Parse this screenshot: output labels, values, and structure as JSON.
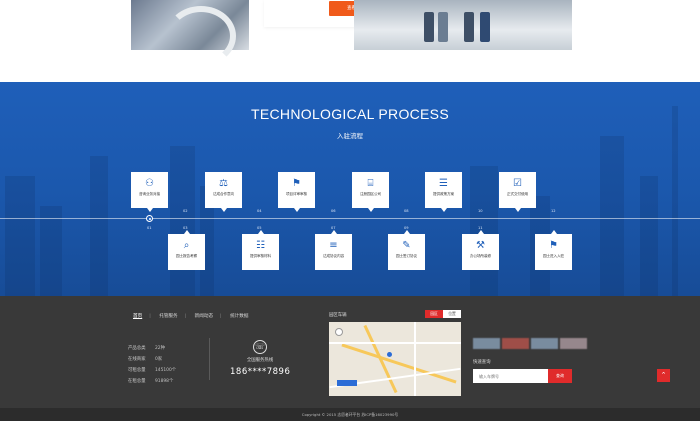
{
  "top": {
    "detail_button": "查看详情"
  },
  "process": {
    "title": "TECHNOLOGICAL PROCESS",
    "subtitle": "入驻流程",
    "steps_top": [
      {
        "label": "咨询业务对接",
        "icon": "users-icon",
        "num": "01"
      },
      {
        "label": "达成合作意向",
        "icon": "handshake-icon",
        "num": "03"
      },
      {
        "label": "项目评审审核",
        "icon": "stamp-icon",
        "num": "05"
      },
      {
        "label": "注册园区公司",
        "icon": "building-icon",
        "num": "07"
      },
      {
        "label": "提供政策方案",
        "icon": "document-icon",
        "num": "09"
      },
      {
        "label": "正式交付使用",
        "icon": "calendar-check-icon",
        "num": "11"
      }
    ],
    "steps_bottom": [
      {
        "label": "园士报告考察",
        "icon": "search-icon",
        "num": "02"
      },
      {
        "label": "提供审核材料",
        "icon": "file-icon",
        "num": "04"
      },
      {
        "label": "达成协议内容",
        "icon": "layers-icon",
        "num": "06"
      },
      {
        "label": "园士签订协议",
        "icon": "sign-icon",
        "num": "08"
      },
      {
        "label": "办公场所装修",
        "icon": "paint-roller-icon",
        "num": "10"
      },
      {
        "label": "园士进入入驻",
        "icon": "flag-icon",
        "num": "12"
      }
    ]
  },
  "footer": {
    "nav": [
      "首页",
      "托管服务",
      "新闻动态",
      "统计数据"
    ],
    "stats": [
      {
        "label": "产品总类",
        "value": "22种"
      },
      {
        "label": "在线商家",
        "value": "0家"
      },
      {
        "label": "可租总量",
        "value": "145100个"
      },
      {
        "label": "在租总量",
        "value": "91898个"
      }
    ],
    "hotline_label": "全国服务热线",
    "hotline_number": "186****7896",
    "map_label": "园区车辆",
    "map_tabs": [
      "园区",
      "位置"
    ],
    "query_label": "快速查询",
    "query_placeholder": "输入车牌号",
    "query_button": "查询",
    "copyright": "Copyright © 2015 志愿者环平台 苏ICP备16023990号"
  },
  "colors": {
    "process_blue": "#1f5fb9",
    "accent_orange": "#f05a1a",
    "accent_red": "#e02b2b",
    "footer_bg": "#393939"
  }
}
